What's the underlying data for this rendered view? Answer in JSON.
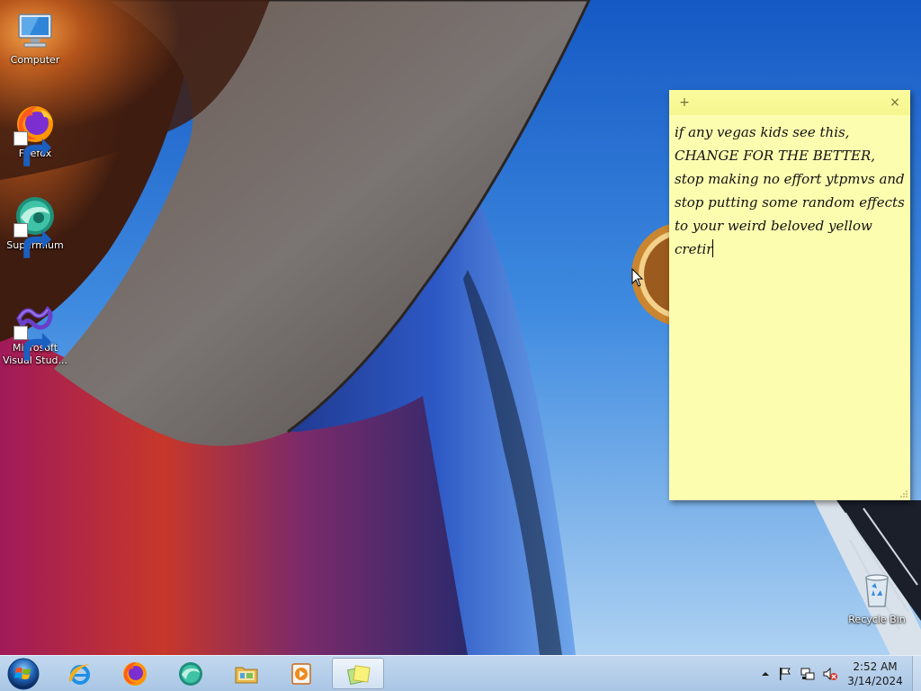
{
  "desktop": {
    "icons": [
      {
        "label": "Computer",
        "icon": "computer-icon",
        "shortcut": false
      },
      {
        "label": "Firefox",
        "icon": "firefox-icon",
        "shortcut": true
      },
      {
        "label": "Supermium",
        "icon": "supermium-icon",
        "shortcut": true
      },
      {
        "label": "Microsoft Visual Stud...",
        "icon": "visual-studio-icon",
        "shortcut": true
      },
      {
        "label": "Recycle Bin",
        "icon": "recycle-bin-icon",
        "shortcut": false
      }
    ]
  },
  "sticky_note": {
    "add_label": "+",
    "close_label": "×",
    "text": "if any vegas kids see this, CHANGE FOR THE BETTER, stop making no effort ytpmvs and stop putting some random effects to your weird beloved yellow cretir",
    "background_color": "#fdfdb0"
  },
  "taskbar": {
    "pinned": [
      {
        "name": "internet-explorer",
        "icon": "internet-explorer-icon",
        "active": false
      },
      {
        "name": "firefox",
        "icon": "firefox-icon",
        "active": false
      },
      {
        "name": "supermium",
        "icon": "supermium-icon",
        "active": false
      },
      {
        "name": "file-explorer",
        "icon": "folder-icon",
        "active": false
      },
      {
        "name": "media-player",
        "icon": "media-player-icon",
        "active": false
      },
      {
        "name": "sticky-notes",
        "icon": "sticky-notes-icon",
        "active": true
      }
    ],
    "tray": {
      "icons": [
        "show-hidden-icons-chevron",
        "action-center-flag-icon",
        "network-icon",
        "volume-muted-icon"
      ]
    },
    "clock": {
      "time": "2:52 AM",
      "date": "3/14/2024"
    }
  }
}
